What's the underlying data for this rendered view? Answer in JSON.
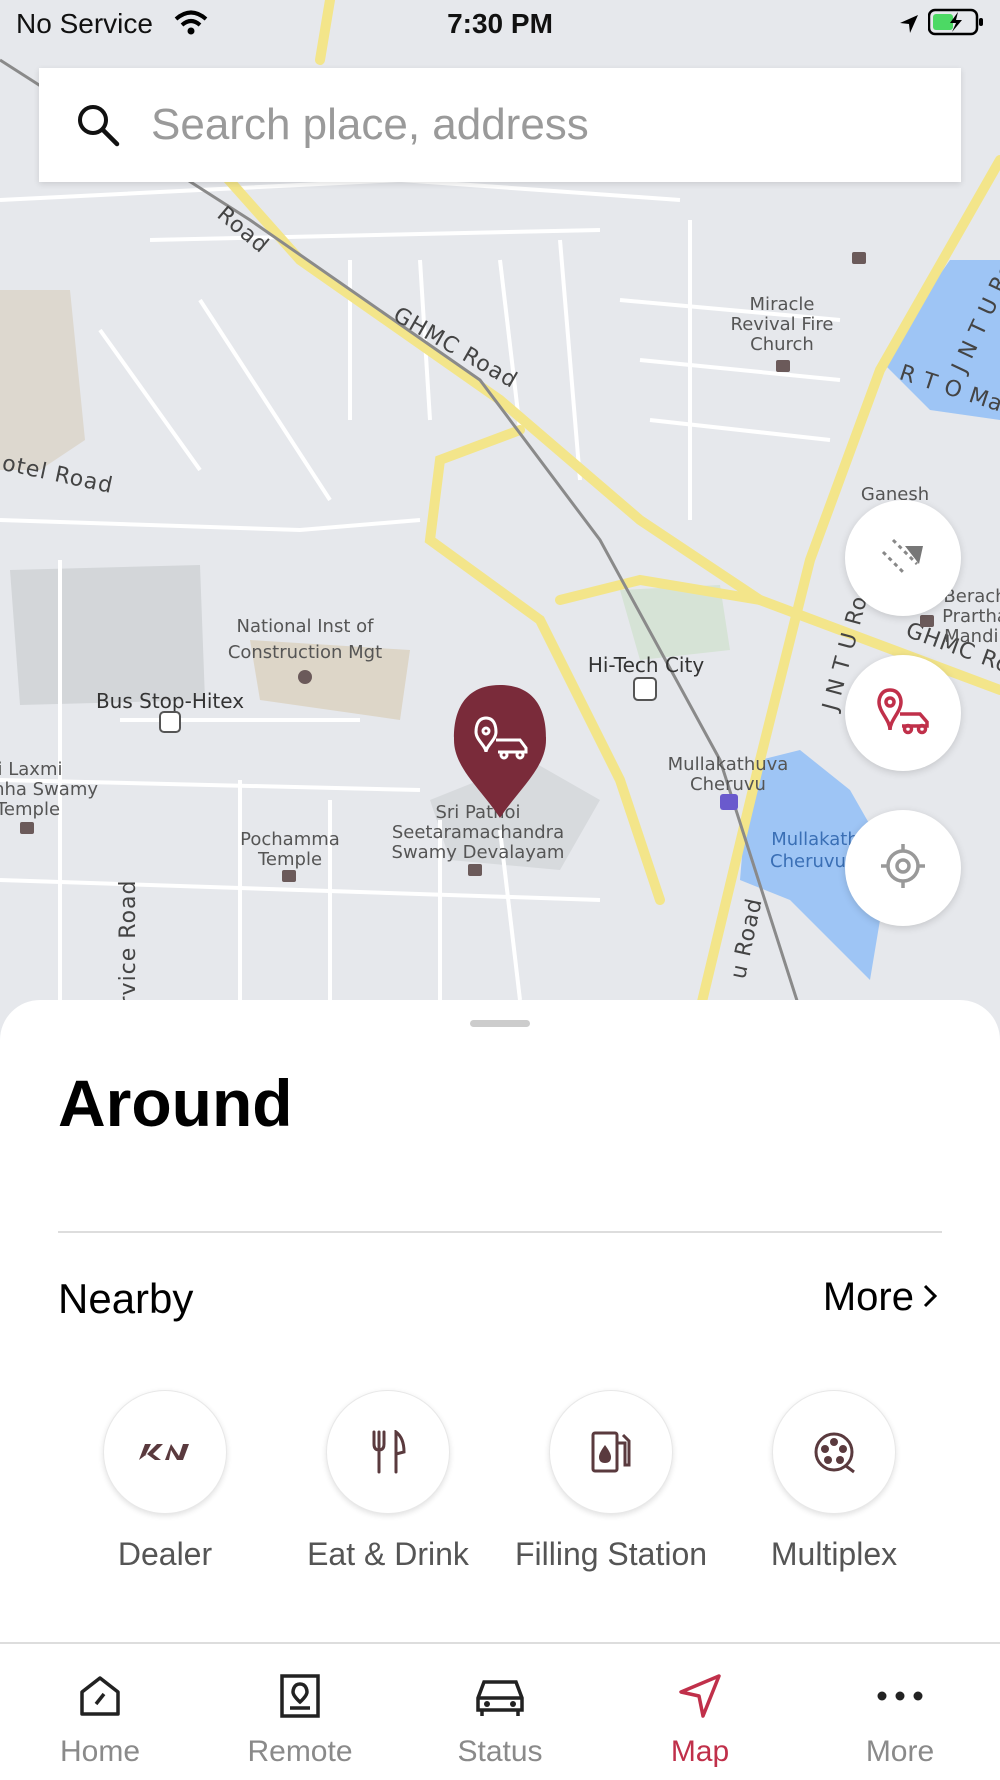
{
  "status_bar": {
    "carrier": "No Service",
    "time": "7:30 PM"
  },
  "search": {
    "placeholder": "Search place, address"
  },
  "map": {
    "labels": {
      "road_top_left": "Road",
      "ghmc_road": "GHMC Road",
      "hotel_road": "otel Road",
      "jntu_road_top": "J N T U Road",
      "jntu_road_mid": "J N T U Road",
      "jntu_road_bottom": "u Road",
      "rto_road": "R T O Ma",
      "ghmc_road_right": "GHMC Ro",
      "service_road": "Service Road",
      "miracle_1": "Miracle",
      "miracle_2": "Revival Fire",
      "miracle_3": "Church",
      "ganesh": "Ganesh",
      "berach_1": "Berach",
      "berach_2": "Prartha",
      "berach_3": "Mandir",
      "nicmar_1": "National Inst of",
      "nicmar_2": "Construction Mgt",
      "hitech": "Hi-Tech City",
      "bus_stop": "Bus Stop-Hitex",
      "laxmi_1": "i Laxmi",
      "laxmi_2": "imha Swamy",
      "laxmi_3": "Temple",
      "pochamma_1": "Pochamma",
      "pochamma_2": "Temple",
      "temple_1": "Sri Patnoi",
      "temple_2": "Seetaramachandra",
      "temple_3": "Swamy Devalayam",
      "mulla_1": "Mullakathuva",
      "mulla_2": "Cheruvu",
      "lake_1": "Mullakath",
      "lake_2": "Cheruvu"
    }
  },
  "sheet": {
    "title": "Around",
    "section": "Nearby",
    "more": "More",
    "categories": [
      {
        "label": "Dealer",
        "icon": "kia-logo-icon"
      },
      {
        "label": "Eat & Drink",
        "icon": "fork-knife-icon"
      },
      {
        "label": "Filling Station",
        "icon": "fuel-pump-icon"
      },
      {
        "label": "Multiplex",
        "icon": "film-reel-icon"
      }
    ]
  },
  "tabs": [
    {
      "label": "Home",
      "icon": "home-gauge-icon"
    },
    {
      "label": "Remote",
      "icon": "remote-icon"
    },
    {
      "label": "Status",
      "icon": "car-icon"
    },
    {
      "label": "Map",
      "icon": "navigation-arrow-icon",
      "active": true
    },
    {
      "label": "More",
      "icon": "ellipsis-icon"
    }
  ],
  "colors": {
    "accent": "#c0304a",
    "pin": "#7a2b3a",
    "map_bg": "#e6e8ec",
    "water": "#9ec5f5",
    "main_road": "#f3e58a"
  }
}
